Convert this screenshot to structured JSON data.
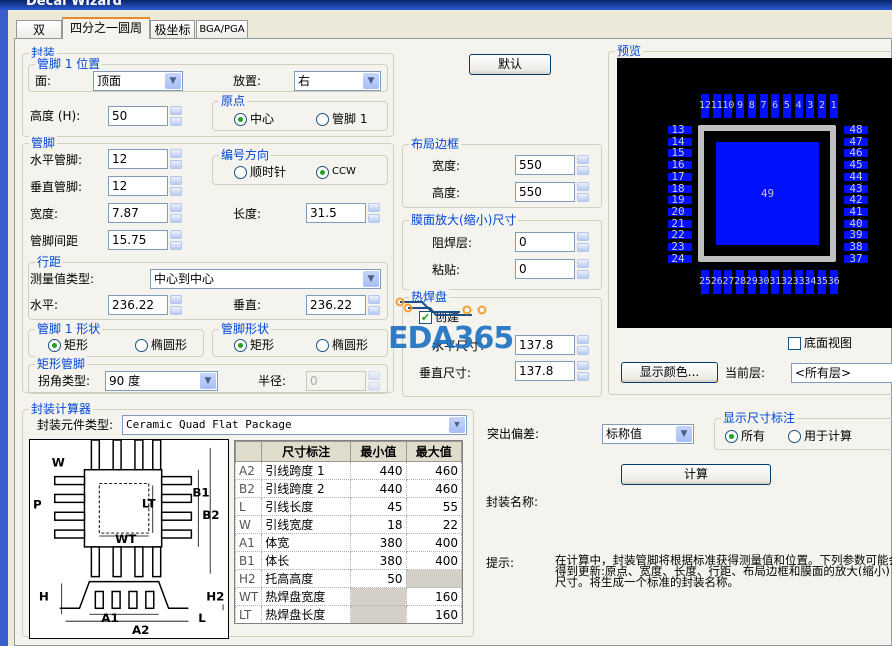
{
  "window": {
    "title": "Decal Wizard"
  },
  "tabs": [
    {
      "label": "双"
    },
    {
      "label": "四分之一圆周"
    },
    {
      "label": "极坐标"
    },
    {
      "label": "BGA/PGA"
    }
  ],
  "package": {
    "title": "封装",
    "pin1_position": {
      "title": "管脚 1 位置",
      "face_label": "面:",
      "face_value": "顶面",
      "place_label": "放置:",
      "place_value": "右"
    },
    "height_label": "高度 (H):",
    "height_value": "50",
    "origin": {
      "title": "原点",
      "center": "中心",
      "pin1": "管脚 1",
      "selected": "中心"
    }
  },
  "pins": {
    "title": "管脚",
    "horizontal_label": "水平管脚:",
    "horizontal_value": "12",
    "vertical_label": "垂直管脚:",
    "vertical_value": "12",
    "numbering": {
      "title": "编号方向",
      "cw": "顺时针",
      "ccw": "CCW",
      "selected": "CCW"
    },
    "width_label": "宽度:",
    "width_value": "7.87",
    "length_label": "长度:",
    "length_value": "31.5",
    "pitch_label": "管脚间距",
    "pitch_value": "15.75",
    "row_spacing": {
      "title": "行距",
      "measure_label": "测量值类型:",
      "measure_value": "中心到中心",
      "h_label": "水平:",
      "h_value": "236.22",
      "v_label": "垂直:",
      "v_value": "236.22"
    },
    "pin1_shape": {
      "title": "管脚 1 形状",
      "rect": "矩形",
      "oval": "椭圆形",
      "selected": "矩形"
    },
    "pin_shape": {
      "title": "管脚形状",
      "rect": "矩形",
      "oval": "椭圆形",
      "selected": "矩形"
    },
    "rect_pin": {
      "title": "矩形管脚",
      "corner_label": "拐角类型:",
      "corner_value": "90 度",
      "radius_label": "半径:",
      "radius_value": "0"
    }
  },
  "default_button": "默认",
  "placement_outline": {
    "title": "布局边框",
    "width_label": "宽度:",
    "width_value": "550",
    "height_label": "高度:",
    "height_value": "550"
  },
  "mask": {
    "title": "膜面放大(缩小)尺寸",
    "solder_label": "阻焊层:",
    "solder_value": "0",
    "paste_label": "粘贴:",
    "paste_value": "0"
  },
  "thermal": {
    "title": "热焊盘",
    "create_label": "创建",
    "create_checked": true,
    "h_label": "水平尺寸:",
    "h_value": "137.8",
    "v_label": "垂直尺寸:",
    "v_value": "137.8"
  },
  "watermark": "EDA365",
  "preview": {
    "title": "预览",
    "top_pins": [
      "12",
      "11",
      "10",
      "9",
      "8",
      "7",
      "6",
      "5",
      "4",
      "3",
      "2",
      "1"
    ],
    "left_pins": [
      "13",
      "14",
      "15",
      "16",
      "17",
      "18",
      "19",
      "20",
      "21",
      "22",
      "23",
      "24"
    ],
    "bottom_pins": [
      "25",
      "26",
      "27",
      "28",
      "29",
      "30",
      "31",
      "32",
      "33",
      "34",
      "35",
      "36"
    ],
    "right_pins": [
      "48",
      "47",
      "46",
      "45",
      "44",
      "43",
      "42",
      "41",
      "40",
      "39",
      "38",
      "37"
    ],
    "center_pad": "49",
    "bottom_view_label": "底面视图",
    "bottom_view_checked": false,
    "colors_button": "显示颜色...",
    "layer_label": "当前层:",
    "layer_value": "<所有层>"
  },
  "calculator": {
    "title": "封装计算器",
    "type_label": "封装元件类型:",
    "type_value": "Ceramic Quad Flat Package",
    "diagram_labels": {
      "W": "W",
      "P": "P",
      "LT": "LT",
      "WT": "WT",
      "B1": "B1",
      "B2": "B2",
      "H": "H",
      "H2": "H2",
      "A1": "A1",
      "A2": "A2",
      "L": "L"
    },
    "columns": [
      "",
      "尺寸标注",
      "最小值",
      "最大值"
    ],
    "rows": [
      {
        "code": "A2",
        "name": "引线跨度 1",
        "min": "440",
        "max": "460"
      },
      {
        "code": "B2",
        "name": "引线跨度 2",
        "min": "440",
        "max": "460"
      },
      {
        "code": "L",
        "name": "引线长度",
        "min": "45",
        "max": "55"
      },
      {
        "code": "W",
        "name": "引线宽度",
        "min": "18",
        "max": "22"
      },
      {
        "code": "A1",
        "name": "体宽",
        "min": "380",
        "max": "400"
      },
      {
        "code": "B1",
        "name": "体长",
        "min": "380",
        "max": "400"
      },
      {
        "code": "H2",
        "name": "托高高度",
        "min": "50",
        "max": ""
      },
      {
        "code": "WT",
        "name": "热焊盘宽度",
        "min": "",
        "max": "160"
      },
      {
        "code": "LT",
        "name": "热焊盘长度",
        "min": "",
        "max": "160"
      }
    ],
    "tolerance_label": "突出偏差:",
    "tolerance_value": "标称值",
    "show_dims": {
      "title": "显示尺寸标注",
      "all": "所有",
      "calc": "用于计算",
      "selected": "所有"
    },
    "calc_button": "计算",
    "name_label": "封装名称:",
    "hint_label": "提示:",
    "hint_text": "在计算中，封装管脚将根据标准获得测量值和位置。下列参数可能会得到更新:原点、宽度、长度、行距、布局边框和膜面的放大(缩小)尺寸。将生成一个标准的封装名称。"
  }
}
